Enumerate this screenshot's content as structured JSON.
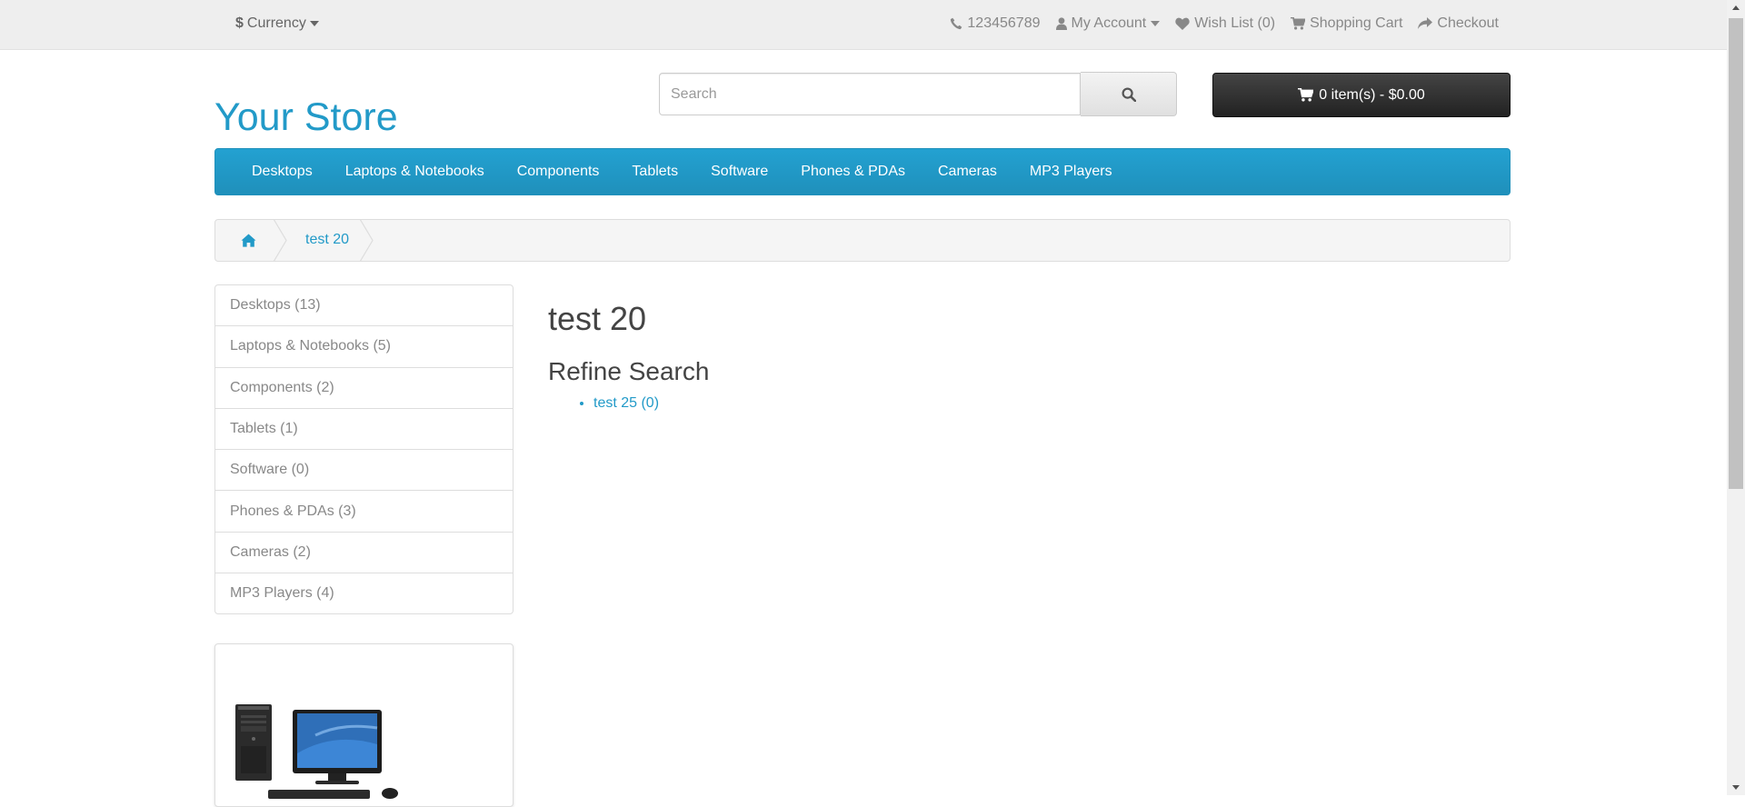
{
  "topbar": {
    "currency_symbol": "$",
    "currency_label": "Currency",
    "phone": "123456789",
    "my_account": "My Account",
    "wishlist": "Wish List (0)",
    "shopping_cart": "Shopping Cart",
    "checkout": "Checkout"
  },
  "header": {
    "logo": "Your Store",
    "search_placeholder": "Search",
    "search_value": "",
    "cart_label": "0 item(s) - $0.00"
  },
  "menu": [
    "Desktops",
    "Laptops & Notebooks",
    "Components",
    "Tablets",
    "Software",
    "Phones & PDAs",
    "Cameras",
    "MP3 Players"
  ],
  "breadcrumb": {
    "current": "test 20"
  },
  "sidebar": {
    "categories": [
      "Desktops (13)",
      "Laptops & Notebooks (5)",
      "Components (2)",
      "Tablets (1)",
      "Software (0)",
      "Phones & PDAs (3)",
      "Cameras (2)",
      "MP3 Players (4)"
    ]
  },
  "content": {
    "title": "test 20",
    "refine_heading": "Refine Search",
    "refine_links": [
      "test 25 (0)"
    ]
  },
  "colors": {
    "accent": "#229ac8",
    "menu_bg": "#229ac8",
    "cart_bg": "#333333",
    "topbar_bg": "#eeeeee"
  },
  "icons": [
    "phone-icon",
    "user-icon",
    "heart-icon",
    "cart-icon",
    "share-icon",
    "search-icon",
    "home-icon",
    "caret-down-icon"
  ]
}
